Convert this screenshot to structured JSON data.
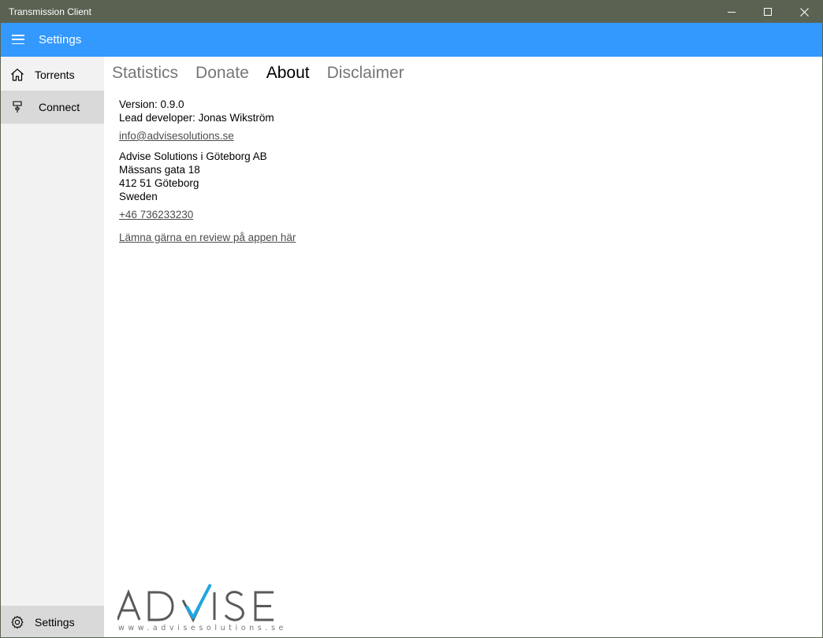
{
  "window": {
    "title": "Transmission Client"
  },
  "appbar": {
    "title": "Settings",
    "menu_icon": "hamburger-icon",
    "accent": "#3399ff"
  },
  "sidebar": {
    "items": [
      {
        "label": "Torrents",
        "icon": "home-icon"
      },
      {
        "label": "Connect",
        "icon": "plug-icon",
        "selected": true
      },
      {
        "label": "Settings",
        "icon": "gear-icon"
      }
    ]
  },
  "tabs": [
    {
      "label": "Statistics"
    },
    {
      "label": "Donate"
    },
    {
      "label": "About",
      "active": true
    },
    {
      "label": "Disclaimer"
    }
  ],
  "about": {
    "version": "Version: 0.9.0",
    "lead_developer": "Lead developer: Jonas Wikström",
    "email": "info@advisesolutions.se",
    "company": "Advise Solutions i Göteborg AB",
    "street": "Mässans gata 18",
    "city": "412 51 Göteborg",
    "country": "Sweden",
    "phone": "+46 736233230",
    "review_link": "Lämna gärna en review på appen här"
  },
  "logo": {
    "wordmark": "ADVISE",
    "url": "www.advisesolutions.se",
    "accent": "#1ea7e1"
  }
}
